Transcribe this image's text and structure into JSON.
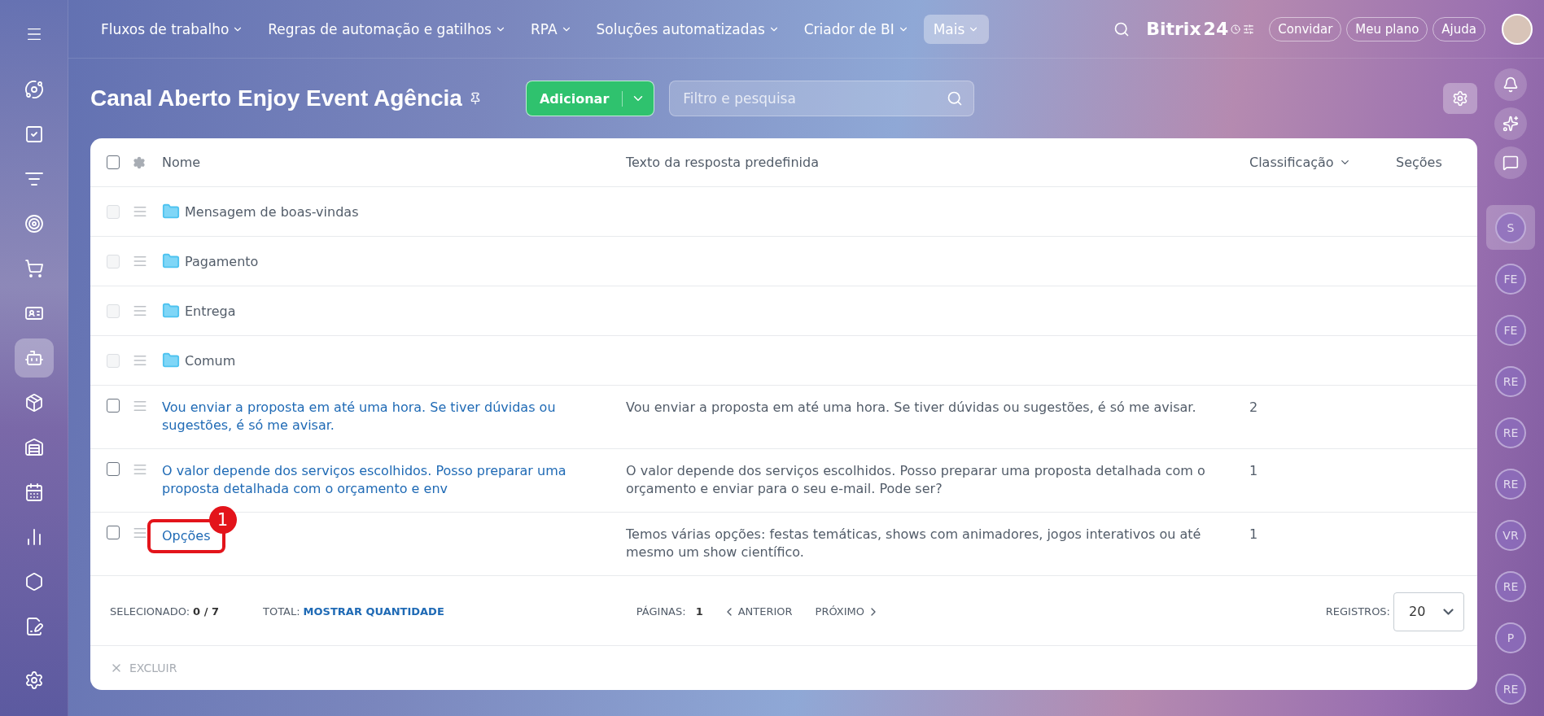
{
  "left_sidebar": {
    "items": [
      {
        "selected": false
      },
      {
        "selected": false
      },
      {
        "selected": false
      },
      {
        "selected": false
      },
      {
        "selected": false
      },
      {
        "selected": false
      },
      {
        "selected": true
      },
      {
        "selected": false
      },
      {
        "selected": false
      },
      {
        "selected": false
      },
      {
        "selected": false
      },
      {
        "selected": false
      },
      {
        "selected": false
      }
    ]
  },
  "top_nav": {
    "items": [
      {
        "label": "Fluxos de trabalho",
        "selected": false
      },
      {
        "label": "Regras de automação e gatilhos",
        "selected": false
      },
      {
        "label": "RPA",
        "selected": false
      },
      {
        "label": "Soluções automatizadas",
        "selected": false
      },
      {
        "label": "Criador de BI",
        "selected": false
      },
      {
        "label": "Mais",
        "selected": true
      }
    ],
    "logo": {
      "name": "Bitrix",
      "suffix": "24"
    },
    "buttons": [
      "Convidar",
      "Meu plano",
      "Ajuda"
    ]
  },
  "page": {
    "title": "Canal Aberto Enjoy Event Agência",
    "add_button": "Adicionar",
    "search": {
      "placeholder": "Filtro e pesquisa"
    }
  },
  "table": {
    "select_all_checked": false,
    "columns": [
      "Nome",
      "Texto da resposta predefinida",
      "Classificação",
      "Seções"
    ],
    "rows": [
      {
        "kind": "folder",
        "name": "Mensagem de boas-vindas",
        "text": "",
        "rank": "",
        "checked": false,
        "disabled": true,
        "callout": ""
      },
      {
        "kind": "folder",
        "name": "Pagamento",
        "text": "",
        "rank": "",
        "checked": false,
        "disabled": true,
        "callout": ""
      },
      {
        "kind": "folder",
        "name": "Entrega",
        "text": "",
        "rank": "",
        "checked": false,
        "disabled": true,
        "callout": ""
      },
      {
        "kind": "folder",
        "name": "Comum",
        "text": "",
        "rank": "",
        "checked": false,
        "disabled": true,
        "callout": ""
      },
      {
        "kind": "reply",
        "name": "Vou enviar a proposta em até uma hora. Se tiver dúvidas ou sugestões, é só me avisar.",
        "text": "Vou enviar a proposta em até uma hora. Se tiver dúvidas ou sugestões, é só me avisar.",
        "rank": "2",
        "checked": false,
        "disabled": false,
        "callout": ""
      },
      {
        "kind": "reply",
        "name": "O valor depende dos serviços escolhidos. Posso preparar uma proposta detalhada com o orçamento e env",
        "text": "O valor depende dos serviços escolhidos. Posso preparar uma proposta detalhada com o orçamento e enviar para o seu e-mail. Pode ser?",
        "rank": "1",
        "checked": false,
        "disabled": false,
        "callout": ""
      },
      {
        "kind": "reply",
        "name": "Opções",
        "text": "Temos várias opções: festas temáticas, shows com animadores, jogos interativos ou até mesmo um show científico.",
        "rank": "1",
        "checked": false,
        "disabled": false,
        "callout": "1"
      }
    ],
    "footer": {
      "selected_label": "SELECIONADO:",
      "selected_value": "0 / 7",
      "total_label": "TOTAL:",
      "total_link": "MOSTRAR QUANTIDADE",
      "pages_label": "PÁGINAS:",
      "page": "1",
      "prev": "ANTERIOR",
      "next": "PRÓXIMO",
      "records_label": "REGISTROS:",
      "records": "20"
    },
    "delete_button": {
      "label": "EXCLUIR",
      "disabled": true
    }
  },
  "right_sidebar": {
    "avatars": [
      {
        "initials": "S",
        "selected": true
      },
      {
        "initials": "FE",
        "selected": false
      },
      {
        "initials": "FE",
        "selected": false
      },
      {
        "initials": "RE",
        "selected": false
      },
      {
        "initials": "RE",
        "selected": false
      },
      {
        "initials": "RE",
        "selected": false
      },
      {
        "initials": "VR",
        "selected": false
      },
      {
        "initials": "RE",
        "selected": false
      },
      {
        "initials": "P",
        "selected": false
      },
      {
        "initials": "RE",
        "selected": false
      }
    ]
  }
}
